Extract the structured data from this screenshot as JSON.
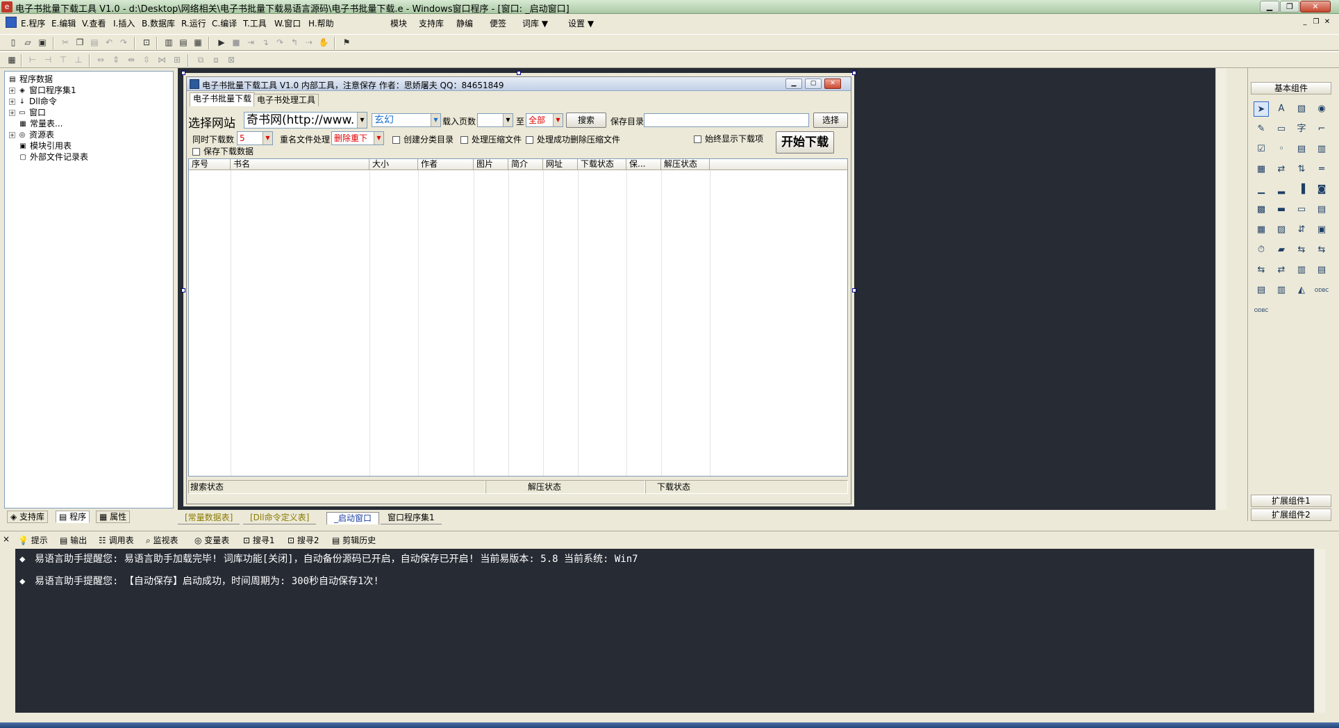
{
  "window": {
    "title": "电子书批量下载工具 V1.0 - d:\\Desktop\\网络相关\\电子书批量下载易语言源码\\电子书批量下载.e - Windows窗口程序 - [窗口: _启动窗口]",
    "minimize": "▁",
    "restore": "❐",
    "close": "✕"
  },
  "menu": {
    "items": [
      "E.程序",
      "E.编辑",
      "V.查看",
      "I.插入",
      "B.数据库",
      "R.运行",
      "C.编译",
      "T.工具",
      "W.窗口",
      "H.帮助"
    ],
    "extras": [
      "模块",
      "支持库",
      "静编",
      "便签",
      "词库 ▼",
      "设置 ▼"
    ],
    "mdi_minimize": "_",
    "mdi_restore": "❐",
    "mdi_close": "✕"
  },
  "left_panel": {
    "tree": [
      {
        "label": "程序数据",
        "icon": "▤",
        "level": 0,
        "expander": ""
      },
      {
        "label": "窗口程序集1",
        "icon": "◈",
        "level": 1,
        "expander": "+"
      },
      {
        "label": "Dll命令",
        "icon": "↓",
        "level": 1,
        "expander": "+"
      },
      {
        "label": "窗口",
        "icon": "▭",
        "level": 1,
        "expander": "+"
      },
      {
        "label": "常量表...",
        "icon": "▦",
        "level": 1,
        "expander": ""
      },
      {
        "label": "资源表",
        "icon": "◎",
        "level": 1,
        "expander": "+"
      },
      {
        "label": "模块引用表",
        "icon": "▣",
        "level": 1,
        "expander": ""
      },
      {
        "label": "外部文件记录表",
        "icon": "▢",
        "level": 1,
        "expander": ""
      }
    ],
    "tabs": [
      "支持库",
      "程序",
      "属性"
    ]
  },
  "form": {
    "title": "电子书批量下载工具 V1.0    内部工具，注意保存    作者：思娇屠夫  QQ：84651849",
    "tabs": [
      "电子书批量下载",
      "电子书处理工具"
    ],
    "site_label": "选择网站",
    "site_value": "奇书网(http://www.",
    "genre_value": "玄幻",
    "pages_label": "载入页数",
    "pages_value": "",
    "to_label": "至",
    "to_value": "全部",
    "search_button": "搜索",
    "save_dir_label": "保存目录",
    "save_dir_value": "",
    "select_button": "选择",
    "concurrent_label": "同时下载数",
    "concurrent_value": "5",
    "rename_label": "重名文件处理",
    "rename_value": "删除重下",
    "checkboxes": [
      "创建分类目录",
      "处理压缩文件",
      "处理成功删除压缩文件"
    ],
    "always_show_label": "始终显示下载项",
    "save_data_label": "保存下载数据",
    "start_button": "开始下载",
    "columns": [
      "序号",
      "书名",
      "大小",
      "作者",
      "图片",
      "简介",
      "网址",
      "下载状态",
      "保...",
      "解压状态"
    ],
    "status": [
      "搜索状态",
      "解压状态",
      "下载状态"
    ]
  },
  "components": {
    "basic_header": "基本组件",
    "ext1": "扩展组件1",
    "ext2": "扩展组件2",
    "icons": [
      "➤",
      "A",
      "▧",
      "◉",
      "✎",
      "▭",
      "字",
      "⌐",
      "☑",
      "◦",
      "▤",
      "▥",
      "▦",
      "⇄",
      "⇅",
      "═",
      "▁",
      "▂",
      "▐",
      "◙",
      "▩",
      "▬",
      "▭",
      "▤",
      "▦",
      "▨",
      "⇵",
      "▣",
      "⏱",
      "▰",
      "⇆",
      "⇆",
      "⇆",
      "⇄",
      "▥",
      "▤",
      "▤",
      "▥",
      "◭",
      "ODBC",
      "ODBC"
    ]
  },
  "doc_tabs": [
    "[常量数据表]",
    "[Dll命令定义表]",
    "_启动窗口",
    "窗口程序集1"
  ],
  "output_tabs": [
    "提示",
    "输出",
    "调用表",
    "监视表",
    "变量表",
    "搜寻1",
    "搜寻2",
    "剪辑历史"
  ],
  "output_lines": [
    "易语言助手提醒您:  易语言助手加载完毕!  词库功能[关闭]，自动备份源码已开启，自动保存已开启!  当前易版本: 5.8  当前系统: Win7",
    "易语言助手提醒您: 【自动保存】启动成功，时间周期为: 300秒自动保存1次!"
  ],
  "colors": {
    "designer_bg": "#262b34",
    "output_bg": "#262b34",
    "accent_red": "#e00000"
  }
}
